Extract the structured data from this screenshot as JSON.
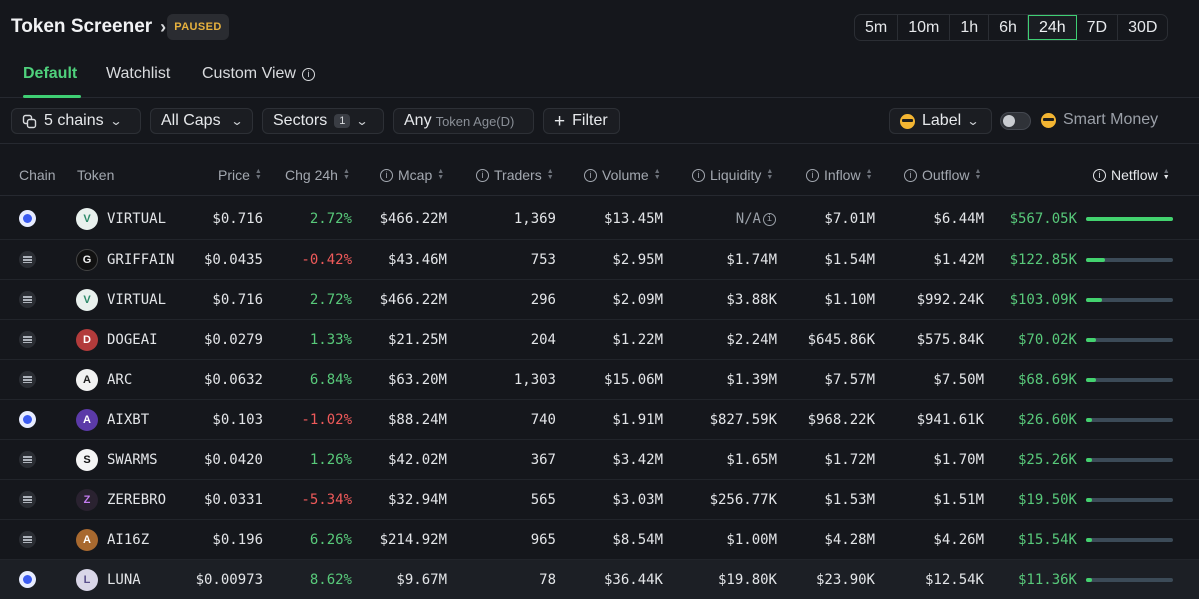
{
  "header": {
    "title": "Token Screener",
    "paused_badge": "PAUSED",
    "timeframes": [
      "5m",
      "10m",
      "1h",
      "6h",
      "24h",
      "7D",
      "30D"
    ],
    "active_timeframe": "24h"
  },
  "tabs": {
    "items": [
      "Default",
      "Watchlist",
      "Custom View"
    ],
    "active": "Default"
  },
  "filters": {
    "chains": "5 chains",
    "caps": "All Caps",
    "sectors": "Sectors",
    "sectors_count": "1",
    "token_age_value": "Any",
    "token_age_label": "Token Age(D)",
    "filter": "Filter",
    "label": "Label",
    "smart_money": "Smart Money",
    "smart_money_enabled": false
  },
  "table": {
    "columns": [
      "Chain",
      "Token",
      "Price",
      "Chg 24h",
      "Mcap",
      "Traders",
      "Volume",
      "Liquidity",
      "Inflow",
      "Outflow",
      "Netflow"
    ],
    "sorted_by": "Netflow",
    "sort_direction": "desc",
    "rows": [
      {
        "chain": "base",
        "token": "VIRTUAL",
        "price": "$0.716",
        "chg": "2.72%",
        "chg_dir": "pos",
        "mcap": "$466.22M",
        "traders": "1,369",
        "volume": "$13.45M",
        "liquidity": "N/A",
        "inflow": "$7.01M",
        "outflow": "$6.44M",
        "netflow": "$567.05K",
        "netflow_fraction": 1.0
      },
      {
        "chain": "solana",
        "token": "GRIFFAIN",
        "price": "$0.0435",
        "chg": "-0.42%",
        "chg_dir": "neg",
        "mcap": "$43.46M",
        "traders": "753",
        "volume": "$2.95M",
        "liquidity": "$1.74M",
        "inflow": "$1.54M",
        "outflow": "$1.42M",
        "netflow": "$122.85K",
        "netflow_fraction": 0.22
      },
      {
        "chain": "solana",
        "token": "VIRTUAL",
        "price": "$0.716",
        "chg": "2.72%",
        "chg_dir": "pos",
        "mcap": "$466.22M",
        "traders": "296",
        "volume": "$2.09M",
        "liquidity": "$3.88K",
        "inflow": "$1.10M",
        "outflow": "$992.24K",
        "netflow": "$103.09K",
        "netflow_fraction": 0.18
      },
      {
        "chain": "solana",
        "token": "DOGEAI",
        "price": "$0.0279",
        "chg": "1.33%",
        "chg_dir": "pos",
        "mcap": "$21.25M",
        "traders": "204",
        "volume": "$1.22M",
        "liquidity": "$2.24M",
        "inflow": "$645.86K",
        "outflow": "$575.84K",
        "netflow": "$70.02K",
        "netflow_fraction": 0.12
      },
      {
        "chain": "solana",
        "token": "ARC",
        "price": "$0.0632",
        "chg": "6.84%",
        "chg_dir": "pos",
        "mcap": "$63.20M",
        "traders": "1,303",
        "volume": "$15.06M",
        "liquidity": "$1.39M",
        "inflow": "$7.57M",
        "outflow": "$7.50M",
        "netflow": "$68.69K",
        "netflow_fraction": 0.12
      },
      {
        "chain": "base",
        "token": "AIXBT",
        "price": "$0.103",
        "chg": "-1.02%",
        "chg_dir": "neg",
        "mcap": "$88.24M",
        "traders": "740",
        "volume": "$1.91M",
        "liquidity": "$827.59K",
        "inflow": "$968.22K",
        "outflow": "$941.61K",
        "netflow": "$26.60K",
        "netflow_fraction": 0.047
      },
      {
        "chain": "solana",
        "token": "SWARMS",
        "price": "$0.0420",
        "chg": "1.26%",
        "chg_dir": "pos",
        "mcap": "$42.02M",
        "traders": "367",
        "volume": "$3.42M",
        "liquidity": "$1.65M",
        "inflow": "$1.72M",
        "outflow": "$1.70M",
        "netflow": "$25.26K",
        "netflow_fraction": 0.045
      },
      {
        "chain": "solana",
        "token": "ZEREBRO",
        "price": "$0.0331",
        "chg": "-5.34%",
        "chg_dir": "neg",
        "mcap": "$32.94M",
        "traders": "565",
        "volume": "$3.03M",
        "liquidity": "$256.77K",
        "inflow": "$1.53M",
        "outflow": "$1.51M",
        "netflow": "$19.50K",
        "netflow_fraction": 0.034
      },
      {
        "chain": "solana",
        "token": "AI16Z",
        "price": "$0.196",
        "chg": "6.26%",
        "chg_dir": "pos",
        "mcap": "$214.92M",
        "traders": "965",
        "volume": "$8.54M",
        "liquidity": "$1.00M",
        "inflow": "$4.28M",
        "outflow": "$4.26M",
        "netflow": "$15.54K",
        "netflow_fraction": 0.027
      },
      {
        "chain": "base",
        "token": "LUNA",
        "price": "$0.00973",
        "chg": "8.62%",
        "chg_dir": "pos",
        "mcap": "$9.67M",
        "traders": "78",
        "volume": "$36.44K",
        "liquidity": "$19.80K",
        "inflow": "$23.90K",
        "outflow": "$12.54K",
        "netflow": "$11.36K",
        "netflow_fraction": 0.02
      }
    ]
  },
  "colors": {
    "accent_green": "#3fcf74",
    "positive": "#58c97a",
    "negative": "#ef5a5a",
    "paused": "#e8b23e",
    "background": "#15171c"
  }
}
